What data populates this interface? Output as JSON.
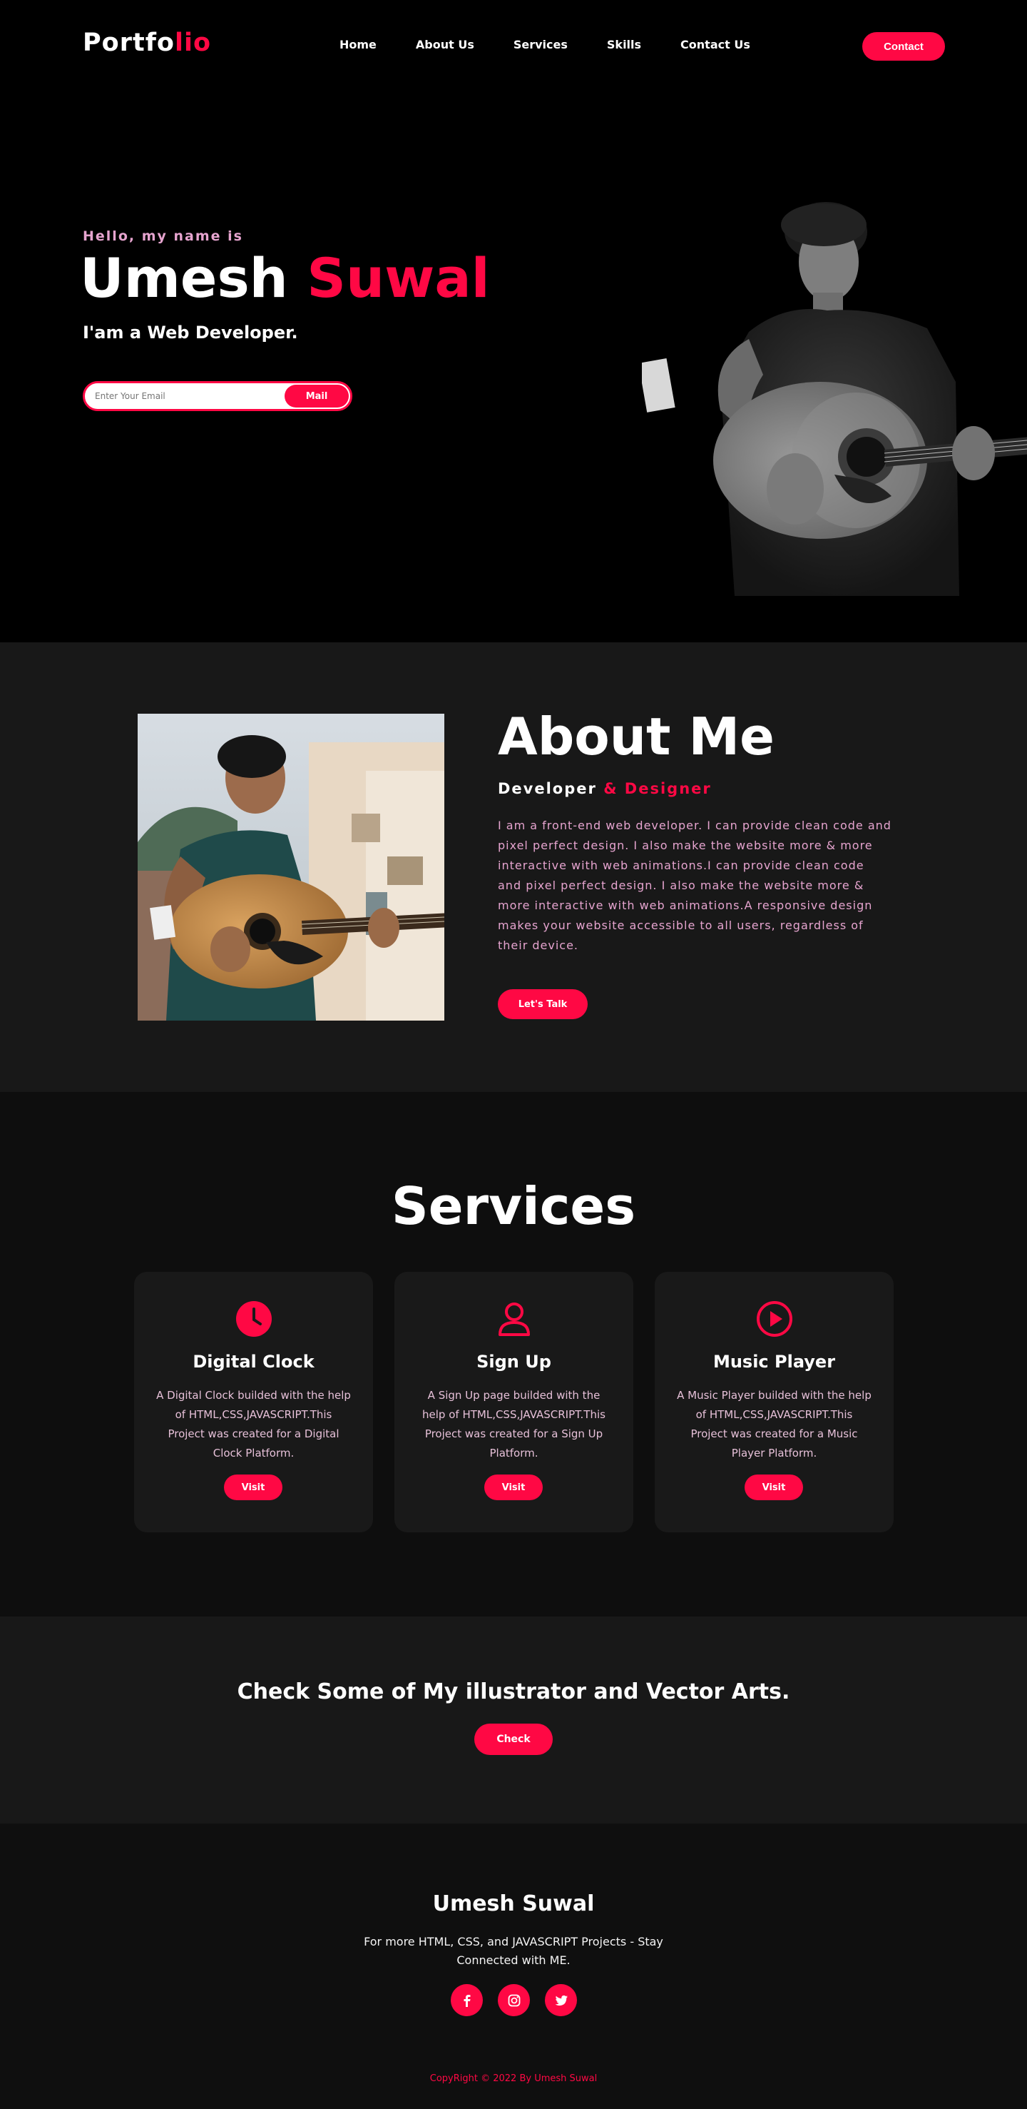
{
  "nav": {
    "logo_main": "Portfo",
    "logo_accent": "lio",
    "links": [
      "Home",
      "About Us",
      "Services",
      "Skills",
      "Contact Us"
    ],
    "cta_label": "Contact"
  },
  "hero": {
    "greeting": "Hello, my name is",
    "first_name": "Umesh",
    "last_name": "Suwal",
    "role": "I'am a Web Developer.",
    "email_placeholder": "Enter Your Email",
    "mail_button": "Mail"
  },
  "about": {
    "title": "About Me",
    "subtitle_main": "Developer",
    "subtitle_accent": "& Designer",
    "text": "I am a front-end web developer. I can provide clean code and pixel perfect design. I also make the website more & more interactive with web animations.I can provide clean code and pixel perfect design. I also make the website more & more interactive with web animations.A responsive design makes your website accessible to all users, regardless of their device.",
    "button": "Let's Talk"
  },
  "services": {
    "title": "Services",
    "cards": [
      {
        "icon": "clock-icon",
        "title": "Digital Clock",
        "text": "A Digital Clock builded with the help of HTML,CSS,JAVASCRIPT.This Project was created for a Digital Clock Platform.",
        "button": "Visit"
      },
      {
        "icon": "user-icon",
        "title": "Sign Up",
        "text": "A Sign Up page builded with the help of HTML,CSS,JAVASCRIPT.This Project was created for a Sign Up Platform.",
        "button": "Visit"
      },
      {
        "icon": "play-icon",
        "title": "Music Player",
        "text": "A Music Player builded with the help of HTML,CSS,JAVASCRIPT.This Project was created for a Music Player Platform.",
        "button": "Visit"
      }
    ]
  },
  "arts": {
    "title": "Check Some of My illustrator and Vector Arts.",
    "button": "Check"
  },
  "footer": {
    "name": "Umesh Suwal",
    "tagline": "For more HTML, CSS, and JAVASCRIPT Projects - Stay Connected with ME.",
    "socials": [
      "facebook-icon",
      "instagram-icon",
      "twitter-icon"
    ],
    "copyright": "CopyRight © 2022 By Umesh Suwal"
  },
  "colors": {
    "accent": "#ff0844",
    "soft_pink": "#e6a4cf",
    "background": "#000000",
    "panel": "#181818"
  }
}
